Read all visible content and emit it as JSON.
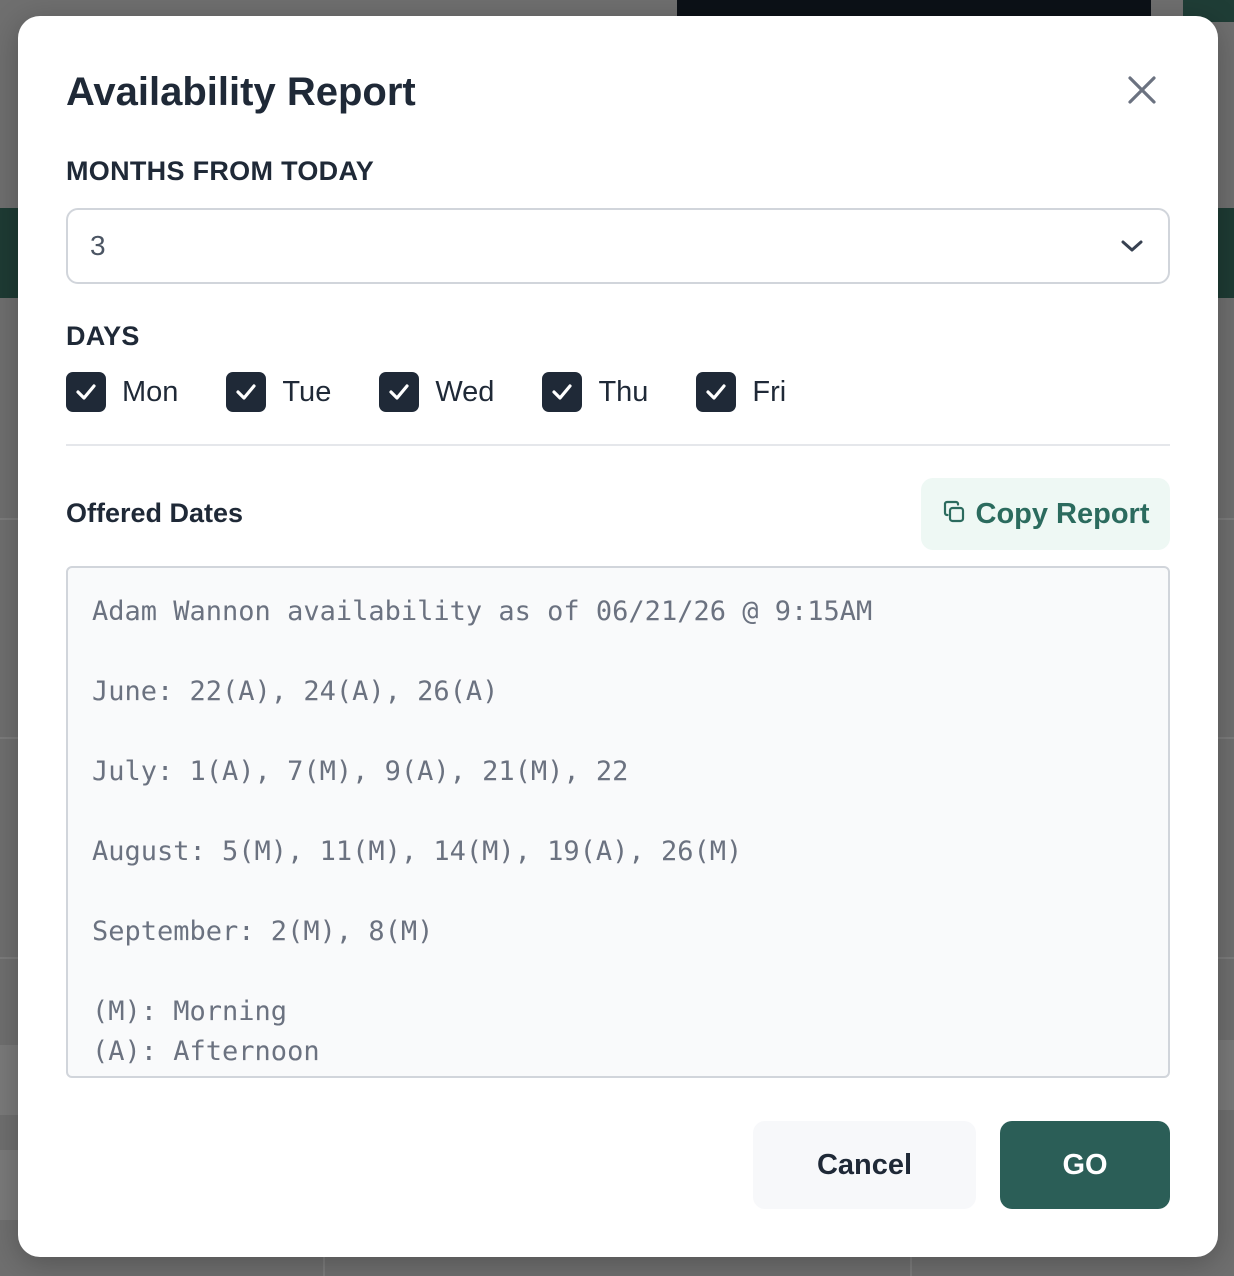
{
  "modal": {
    "title": "Availability Report",
    "close_icon": "close-icon"
  },
  "months": {
    "label": "MONTHS FROM TODAY",
    "selected_value": "3",
    "icon": "chevron-down-icon"
  },
  "days": {
    "label": "DAYS",
    "items": [
      {
        "label": "Mon",
        "checked": true
      },
      {
        "label": "Tue",
        "checked": true
      },
      {
        "label": "Wed",
        "checked": true
      },
      {
        "label": "Thu",
        "checked": true
      },
      {
        "label": "Fri",
        "checked": true
      }
    ]
  },
  "offered_dates": {
    "label": "Offered Dates",
    "copy_button_label": "Copy Report",
    "copy_icon": "copy-icon",
    "report_lines": [
      "Adam Wannon availability as of 06/21/26 @ 9:15AM",
      "",
      "June: 22(A), 24(A), 26(A)",
      "",
      "July: 1(A), 7(M), 9(A), 21(M), 22",
      "",
      "August: 5(M), 11(M), 14(M), 19(A), 26(M)",
      "",
      "September: 2(M), 8(M)",
      "",
      "(M): Morning",
      "(A): Afternoon"
    ]
  },
  "footer": {
    "cancel_label": "Cancel",
    "go_label": "GO"
  },
  "colors": {
    "primary": "#2b5e57",
    "checkbox": "#1f2937",
    "copy_button_bg": "#eef8f4",
    "copy_button_text": "#2b6b5e"
  }
}
